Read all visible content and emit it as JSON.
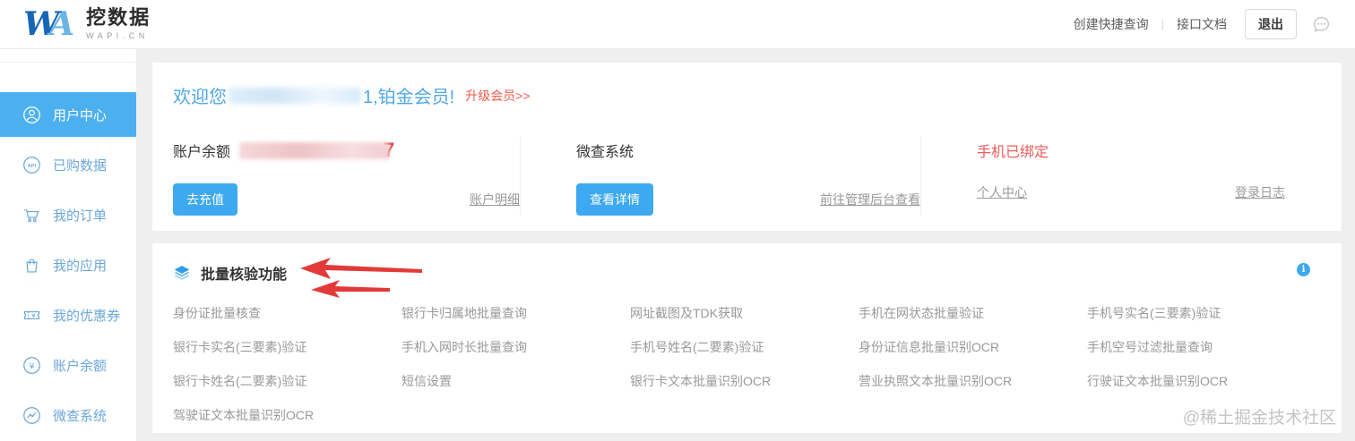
{
  "header": {
    "brand": {
      "logo_w": "W",
      "logo_a": "A",
      "name": "挖数据",
      "domain": "WAPI.CN"
    },
    "quick_query_link": "创建快捷查询",
    "docs_link": "接口文档",
    "logout_button": "退出"
  },
  "sidebar": {
    "items": [
      {
        "label": "用户中心",
        "icon": "user",
        "active": true
      },
      {
        "label": "已购数据",
        "icon": "api",
        "active": false
      },
      {
        "label": "我的订单",
        "icon": "cart",
        "active": false
      },
      {
        "label": "我的应用",
        "icon": "bag",
        "active": false
      },
      {
        "label": "我的优惠券",
        "icon": "coupon",
        "active": false
      },
      {
        "label": "账户余额",
        "icon": "yuan",
        "active": false
      },
      {
        "label": "微查系统",
        "icon": "chart",
        "active": false
      }
    ]
  },
  "overview": {
    "welcome_prefix": "欢迎您",
    "welcome_suffix": "1,铂金会员!",
    "upgrade_link": "升级会员>>",
    "balance": {
      "label": "账户余额",
      "visible_digit": "7",
      "recharge_button": "去充值",
      "detail_link": "账户明细"
    },
    "wecha_system": {
      "label": "微查系统",
      "detail_button": "查看详情",
      "admin_link": "前往管理后台查看"
    },
    "phone": {
      "status": "手机已绑定",
      "profile_link": "个人中心",
      "login_log_link": "登录日志"
    }
  },
  "batch": {
    "title": "批量核验功能",
    "items": [
      "身份证批量核查",
      "银行卡归属地批量查询",
      "网址截图及TDK获取",
      "手机在网状态批量验证",
      "手机号实名(三要素)验证",
      "银行卡实名(三要素)验证",
      "手机入网时长批量查询",
      "手机号姓名(二要素)验证",
      "身份证信息批量识别OCR",
      "手机空号过滤批量查询",
      "银行卡姓名(二要素)验证",
      "短信设置",
      "银行卡文本批量识别OCR",
      "营业执照文本批量识别OCR",
      "行驶证文本批量识别OCR",
      "驾驶证文本批量识别OCR"
    ]
  },
  "watermark": "@稀土掘金技术社区",
  "colors": {
    "accent_blue": "#3ca9f0",
    "sidebar_active": "#4cb0f0",
    "welcome_blue": "#4fa8e8",
    "alert_red": "#f25b4a"
  }
}
